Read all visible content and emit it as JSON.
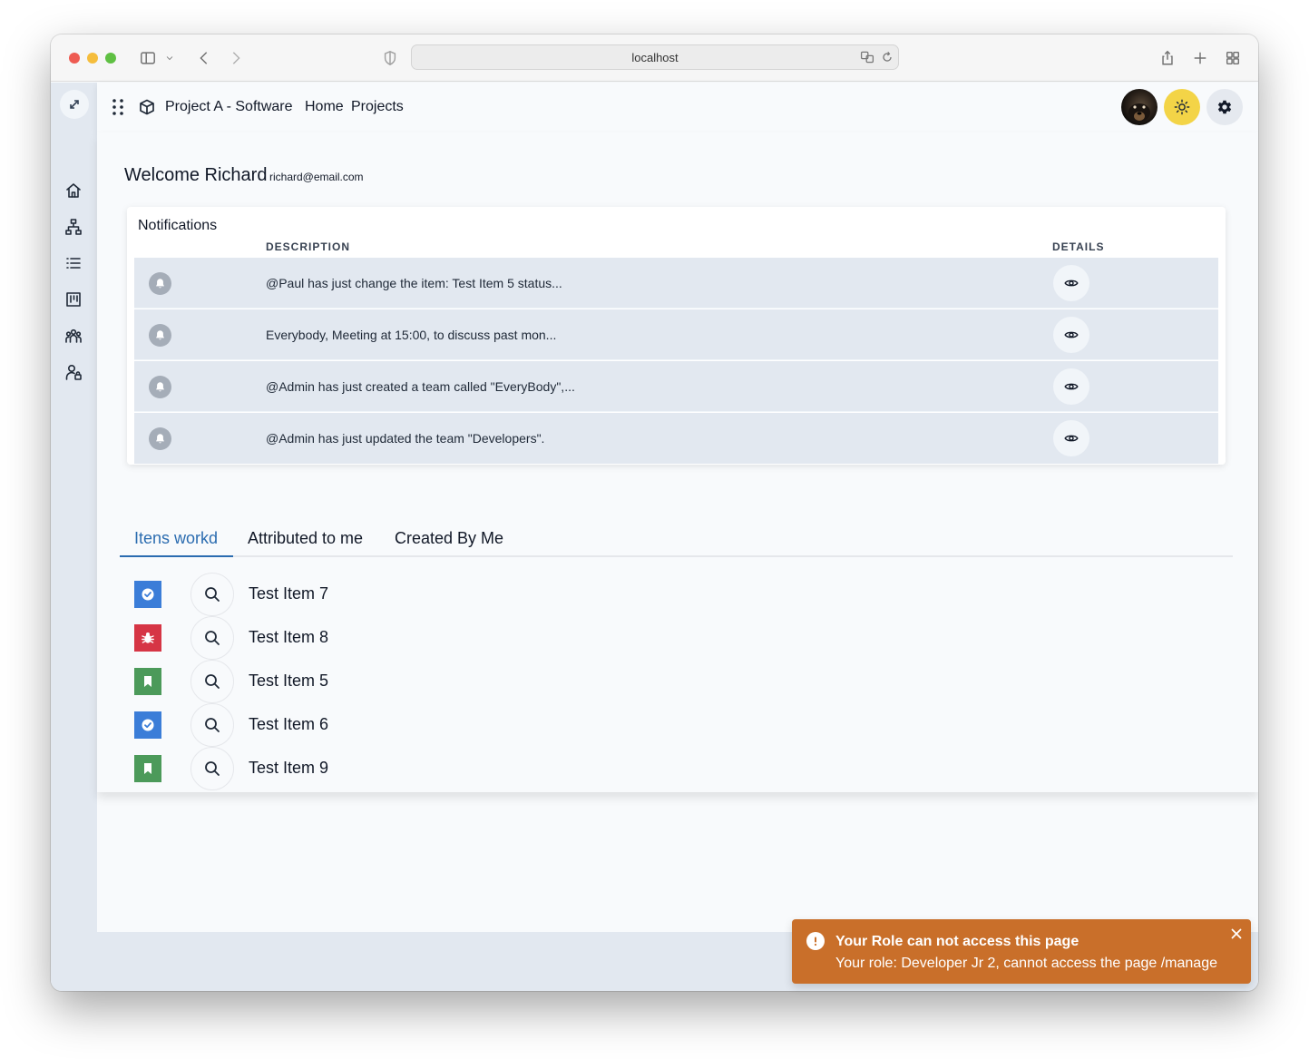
{
  "browser": {
    "url": "localhost",
    "icons": [
      "sidebar-toggle-icon",
      "chevron-down-icon",
      "back-icon",
      "forward-icon",
      "shield-icon",
      "translate-icon",
      "reload-icon",
      "share-icon",
      "new-tab-icon",
      "tab-overview-icon"
    ]
  },
  "header": {
    "project_title": "Project A - Software",
    "nav_home": "Home",
    "nav_projects": "Projects"
  },
  "sidebar": {
    "items": [
      "home-icon",
      "hierarchy-icon",
      "list-icon",
      "board-icon",
      "team-icon",
      "user-lock-icon"
    ]
  },
  "welcome": {
    "title": "Welcome Richard",
    "email": "richard@email.com"
  },
  "notifications": {
    "title": "Notifications",
    "columns": {
      "description": "DESCRIPTION",
      "details": "DETAILS"
    },
    "rows": [
      {
        "description": "@Paul has just change the item: Test Item 5 status..."
      },
      {
        "description": "Everybody, Meeting at 15:00, to discuss past mon..."
      },
      {
        "description": "@Admin has just created a team called \"EveryBody\",..."
      },
      {
        "description": "@Admin has just updated the team \"Developers\"."
      }
    ]
  },
  "tabs": [
    {
      "label": "Itens workd",
      "active": true
    },
    {
      "label": "Attributed to me",
      "active": false
    },
    {
      "label": "Created By Me",
      "active": false
    }
  ],
  "items": [
    {
      "name": "Test Item 7",
      "type": "task",
      "color": "#3b7dd8"
    },
    {
      "name": "Test Item 8",
      "type": "bug",
      "color": "#d63545"
    },
    {
      "name": "Test Item 5",
      "type": "story",
      "color": "#4c9a5a"
    },
    {
      "name": "Test Item 6",
      "type": "task",
      "color": "#3b7dd8"
    },
    {
      "name": "Test Item 9",
      "type": "story",
      "color": "#4c9a5a"
    }
  ],
  "toast": {
    "title": "Your Role can not access this page",
    "message": "Your role: Developer Jr 2, cannot access the page /manage",
    "color": "#c96f2a"
  },
  "colors": {
    "accent": "#2b6cb0",
    "theme_toggle": "#f3d447",
    "sidebar_bg": "#e2e8f0"
  }
}
